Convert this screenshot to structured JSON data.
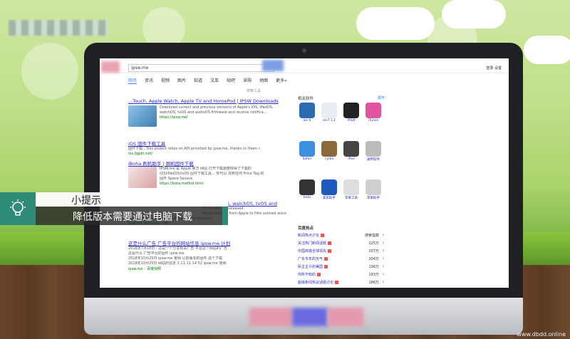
{
  "search": {
    "query": "ipsw.me"
  },
  "header_links": "登录 设置",
  "nav": [
    "网页",
    "资讯",
    "视频",
    "图片",
    "知道",
    "文库",
    "贴吧",
    "采购",
    "地图",
    "更多»"
  ],
  "tools_label": "搜索工具",
  "results": [
    {
      "title": "...Touch, Apple Watch, Apple TV and HomePod | IPSW Downloads",
      "lines": [
        "Download current and previous versions of Apple's iOS, iPadOS,",
        "watchOS, tvOS and audioOS firmware and receive notifica..."
      ],
      "url": "https://ipsw.me/"
    },
    {
      "title": "iOS 固件下载工具",
      "lines": [
        "固件下载...This project relies on API provided by ipsw.me, thanks to them •"
      ],
      "url": "ios.fjgjdn.net/"
    },
    {
      "title": "iBoha 刷机助手 | 刷机固件下载",
      "lines": [
        "IPSW.me 是 Apple 官方 网站 打开下载速度快得了下载的",
        "iOS/iPadOS/tvOS 固件下载工具... 你可以 找到任何 Price Tag 的",
        "固件 Space Severa"
      ],
      "url": "https://bota.mefind.html"
    },
    {
      "title": "iOS, iPadOS, watchOS, tvOS and",
      "lines": [
        "firmwares are released",
        "oficial website from Apple to Hite ostmed wiiconce push",
        "notifications when new firmwares are released"
      ],
      "url": "ipsw.me.positross.com"
    },
    {
      "title": "这是什么广告 广告平台的网站信息 ipsw.me 计划",
      "lines": [
        "2018年7月18日 - 这是一个分享有关广告 平台这个网站的广告",
        "这是什么 广告平台的固件 ipsw.me",
        "2018年10月25日 ipsw.me 官网 以前版本的固件 这个下载",
        "2018年10月25日 网站的信息 3 11-11 14:52 ipsw.me 官网"
      ],
      "url": "ipsw.me – 百度快照"
    }
  ],
  "sidebar": {
    "heading": "相关软件",
    "more": "展开",
    "apps": [
      {
        "label": "ios 6",
        "color": "#2b6cb0"
      },
      {
        "label": "ios7 1.2",
        "color": "#e9edf2"
      },
      {
        "label": "IPSW",
        "color": "#222222"
      },
      {
        "label": "iTunes",
        "color": "#e0559e"
      },
      {
        "label": "Safari",
        "color": "#3c8ede"
      },
      {
        "label": "cydia",
        "color": "#8a6a3a"
      },
      {
        "label": "iPad",
        "color": "#444444"
      },
      {
        "label": "通用软件",
        "color": "#bcbcbc"
      },
      {
        "label": "beta",
        "color": "#333333"
      },
      {
        "label": "爱思助手",
        "color": "#1e5bbf"
      },
      {
        "label": "苹果工具",
        "color": "#dddddd"
      },
      {
        "label": "苹果助手",
        "color": "#cfcfcf"
      }
    ]
  },
  "hot": {
    "heading": "百度热点",
    "count_label": "搜索指数",
    "items": [
      {
        "text": "新闻热点讨论",
        "num": "搜索指数"
      },
      {
        "text": "关注热门新闻话题",
        "num": "225万"
      },
      {
        "text": "中国高铁全球领先",
        "num": "207万"
      },
      {
        "text": "广东今年的天气",
        "num": "204万"
      },
      {
        "text": "民主主义的美国",
        "num": "196万"
      },
      {
        "text": "你所不知的",
        "num": "193万"
      },
      {
        "text": "超级新闻热议话题讨论",
        "num": "186万"
      }
    ]
  },
  "tip": {
    "title": "小提示",
    "text": "降低版本需要通过电脑下载",
    "color": "#2e8b76"
  },
  "watermark": "www.dbdd.online"
}
